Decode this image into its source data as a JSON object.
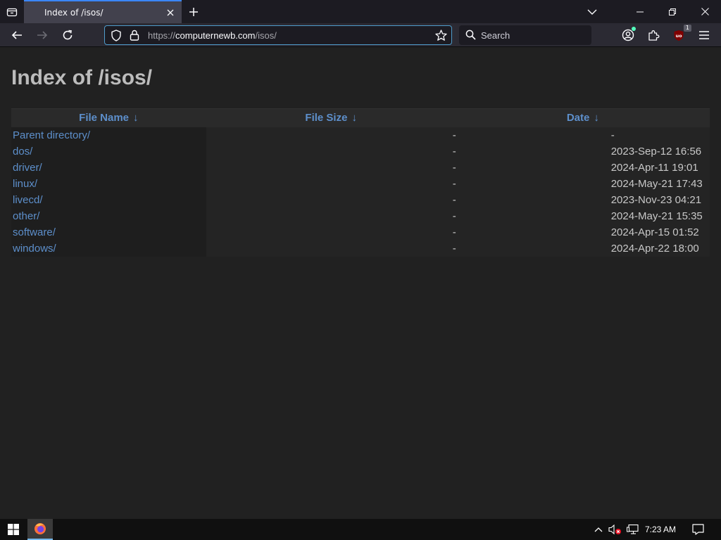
{
  "browser": {
    "tab": {
      "title": "Index of /isos/"
    },
    "url": {
      "scheme": "https://",
      "host": "computernewb.com",
      "path": "/isos/"
    },
    "search": {
      "placeholder": "Search"
    },
    "extension_badge": "1"
  },
  "page": {
    "title": "Index of /isos/",
    "columns": [
      {
        "label": "File Name",
        "sort_indicator": "↓"
      },
      {
        "label": "File Size",
        "sort_indicator": "↓"
      },
      {
        "label": "Date",
        "sort_indicator": "↓"
      }
    ],
    "rows": [
      {
        "name": "Parent directory/",
        "size": "-",
        "date": "-"
      },
      {
        "name": "dos/",
        "size": "-",
        "date": "2023-Sep-12 16:56"
      },
      {
        "name": "driver/",
        "size": "-",
        "date": "2024-Apr-11 19:01"
      },
      {
        "name": "linux/",
        "size": "-",
        "date": "2024-May-21 17:43"
      },
      {
        "name": "livecd/",
        "size": "-",
        "date": "2023-Nov-23 04:21"
      },
      {
        "name": "other/",
        "size": "-",
        "date": "2024-May-21 15:35"
      },
      {
        "name": "software/",
        "size": "-",
        "date": "2024-Apr-15 01:52"
      },
      {
        "name": "windows/",
        "size": "-",
        "date": "2024-Apr-22 18:00"
      }
    ]
  },
  "taskbar": {
    "clock": "7:23 AM",
    "pinned": [
      "firefox-icon"
    ]
  },
  "colors": {
    "link": "#5d8fcb",
    "tab_accent": "#3a86ff",
    "page_bg": "#212121",
    "title": "#bcbcbc"
  }
}
